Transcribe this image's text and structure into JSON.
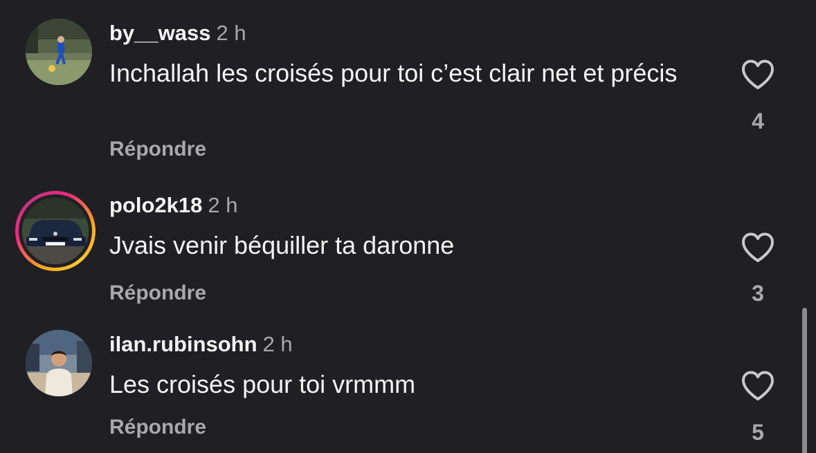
{
  "comments": [
    {
      "username": "by__wass",
      "time": "2 h",
      "text": "Inchallah les croisés pour toi c’est clair net et précis",
      "reply_label": "Répondre",
      "likes": "4",
      "has_story_ring": false
    },
    {
      "username": "polo2k18",
      "time": "2 h",
      "text": "Jvais venir béquiller ta daronne",
      "reply_label": "Répondre",
      "likes": "3",
      "has_story_ring": true
    },
    {
      "username": "ilan.rubinsohn",
      "time": "2 h",
      "text": "Les croisés pour toi vrmmm",
      "reply_label": "Répondre",
      "likes": "5",
      "has_story_ring": false
    }
  ],
  "icons": {
    "like": "heart-outline-icon"
  },
  "colors": {
    "background": "#202024",
    "primary_text": "#f5f5f5",
    "secondary_text": "#a8a8ad",
    "story_ring_start": "#f9a825",
    "story_ring_end": "#ee2a7b"
  }
}
